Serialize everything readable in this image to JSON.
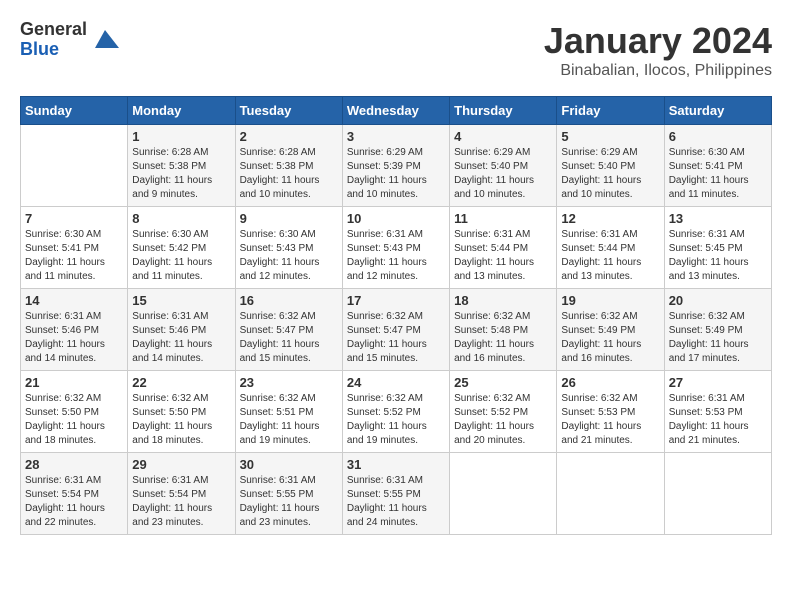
{
  "logo": {
    "general": "General",
    "blue": "Blue"
  },
  "title": "January 2024",
  "subtitle": "Binabalian, Ilocos, Philippines",
  "headers": [
    "Sunday",
    "Monday",
    "Tuesday",
    "Wednesday",
    "Thursday",
    "Friday",
    "Saturday"
  ],
  "weeks": [
    [
      {
        "day": "",
        "sunrise": "",
        "sunset": "",
        "daylight": ""
      },
      {
        "day": "1",
        "sunrise": "6:28 AM",
        "sunset": "5:38 PM",
        "daylight": "11 hours and 9 minutes."
      },
      {
        "day": "2",
        "sunrise": "6:28 AM",
        "sunset": "5:38 PM",
        "daylight": "11 hours and 10 minutes."
      },
      {
        "day": "3",
        "sunrise": "6:29 AM",
        "sunset": "5:39 PM",
        "daylight": "11 hours and 10 minutes."
      },
      {
        "day": "4",
        "sunrise": "6:29 AM",
        "sunset": "5:40 PM",
        "daylight": "11 hours and 10 minutes."
      },
      {
        "day": "5",
        "sunrise": "6:29 AM",
        "sunset": "5:40 PM",
        "daylight": "11 hours and 10 minutes."
      },
      {
        "day": "6",
        "sunrise": "6:30 AM",
        "sunset": "5:41 PM",
        "daylight": "11 hours and 11 minutes."
      }
    ],
    [
      {
        "day": "7",
        "sunrise": "6:30 AM",
        "sunset": "5:41 PM",
        "daylight": "11 hours and 11 minutes."
      },
      {
        "day": "8",
        "sunrise": "6:30 AM",
        "sunset": "5:42 PM",
        "daylight": "11 hours and 11 minutes."
      },
      {
        "day": "9",
        "sunrise": "6:30 AM",
        "sunset": "5:43 PM",
        "daylight": "11 hours and 12 minutes."
      },
      {
        "day": "10",
        "sunrise": "6:31 AM",
        "sunset": "5:43 PM",
        "daylight": "11 hours and 12 minutes."
      },
      {
        "day": "11",
        "sunrise": "6:31 AM",
        "sunset": "5:44 PM",
        "daylight": "11 hours and 13 minutes."
      },
      {
        "day": "12",
        "sunrise": "6:31 AM",
        "sunset": "5:44 PM",
        "daylight": "11 hours and 13 minutes."
      },
      {
        "day": "13",
        "sunrise": "6:31 AM",
        "sunset": "5:45 PM",
        "daylight": "11 hours and 13 minutes."
      }
    ],
    [
      {
        "day": "14",
        "sunrise": "6:31 AM",
        "sunset": "5:46 PM",
        "daylight": "11 hours and 14 minutes."
      },
      {
        "day": "15",
        "sunrise": "6:31 AM",
        "sunset": "5:46 PM",
        "daylight": "11 hours and 14 minutes."
      },
      {
        "day": "16",
        "sunrise": "6:32 AM",
        "sunset": "5:47 PM",
        "daylight": "11 hours and 15 minutes."
      },
      {
        "day": "17",
        "sunrise": "6:32 AM",
        "sunset": "5:47 PM",
        "daylight": "11 hours and 15 minutes."
      },
      {
        "day": "18",
        "sunrise": "6:32 AM",
        "sunset": "5:48 PM",
        "daylight": "11 hours and 16 minutes."
      },
      {
        "day": "19",
        "sunrise": "6:32 AM",
        "sunset": "5:49 PM",
        "daylight": "11 hours and 16 minutes."
      },
      {
        "day": "20",
        "sunrise": "6:32 AM",
        "sunset": "5:49 PM",
        "daylight": "11 hours and 17 minutes."
      }
    ],
    [
      {
        "day": "21",
        "sunrise": "6:32 AM",
        "sunset": "5:50 PM",
        "daylight": "11 hours and 18 minutes."
      },
      {
        "day": "22",
        "sunrise": "6:32 AM",
        "sunset": "5:50 PM",
        "daylight": "11 hours and 18 minutes."
      },
      {
        "day": "23",
        "sunrise": "6:32 AM",
        "sunset": "5:51 PM",
        "daylight": "11 hours and 19 minutes."
      },
      {
        "day": "24",
        "sunrise": "6:32 AM",
        "sunset": "5:52 PM",
        "daylight": "11 hours and 19 minutes."
      },
      {
        "day": "25",
        "sunrise": "6:32 AM",
        "sunset": "5:52 PM",
        "daylight": "11 hours and 20 minutes."
      },
      {
        "day": "26",
        "sunrise": "6:32 AM",
        "sunset": "5:53 PM",
        "daylight": "11 hours and 21 minutes."
      },
      {
        "day": "27",
        "sunrise": "6:31 AM",
        "sunset": "5:53 PM",
        "daylight": "11 hours and 21 minutes."
      }
    ],
    [
      {
        "day": "28",
        "sunrise": "6:31 AM",
        "sunset": "5:54 PM",
        "daylight": "11 hours and 22 minutes."
      },
      {
        "day": "29",
        "sunrise": "6:31 AM",
        "sunset": "5:54 PM",
        "daylight": "11 hours and 23 minutes."
      },
      {
        "day": "30",
        "sunrise": "6:31 AM",
        "sunset": "5:55 PM",
        "daylight": "11 hours and 23 minutes."
      },
      {
        "day": "31",
        "sunrise": "6:31 AM",
        "sunset": "5:55 PM",
        "daylight": "11 hours and 24 minutes."
      },
      {
        "day": "",
        "sunrise": "",
        "sunset": "",
        "daylight": ""
      },
      {
        "day": "",
        "sunrise": "",
        "sunset": "",
        "daylight": ""
      },
      {
        "day": "",
        "sunrise": "",
        "sunset": "",
        "daylight": ""
      }
    ]
  ],
  "labels": {
    "sunrise_prefix": "Sunrise: ",
    "sunset_prefix": "Sunset: ",
    "daylight_prefix": "Daylight: "
  }
}
